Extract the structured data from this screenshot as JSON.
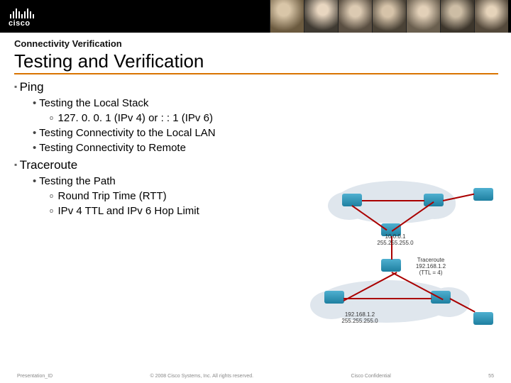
{
  "brand": {
    "name": "cisco"
  },
  "header": {
    "pretitle": "Connectivity Verification",
    "title": "Testing and Verification"
  },
  "sections": [
    {
      "head": "Ping",
      "items": [
        {
          "text": "Testing the Local Stack",
          "sub": [
            {
              "text": "127. 0. 0. 1 (IPv 4) or : : 1 (IPv 6)"
            }
          ]
        },
        {
          "text": "Testing Connectivity to the Local LAN"
        },
        {
          "text": "Testing Connectivity to Remote"
        }
      ]
    },
    {
      "head": "Traceroute",
      "items": [
        {
          "text": "Testing the Path",
          "sub": [
            {
              "text": "Round Trip Time (RTT)"
            },
            {
              "text": "IPv 4 TTL and IPv 6 Hop Limit"
            }
          ]
        }
      ]
    }
  ],
  "diagram": {
    "net1": "10.0.0.1\n255.255.255.0",
    "trace": "Traceroute\n192.168.1.2\n(TTL = 4)",
    "net2": "192.168.1.2\n255.255.255.0"
  },
  "footer": {
    "left": "Presentation_ID",
    "center": "© 2008 Cisco Systems, Inc. All rights reserved.",
    "right": "Cisco Confidential",
    "page": "55"
  }
}
